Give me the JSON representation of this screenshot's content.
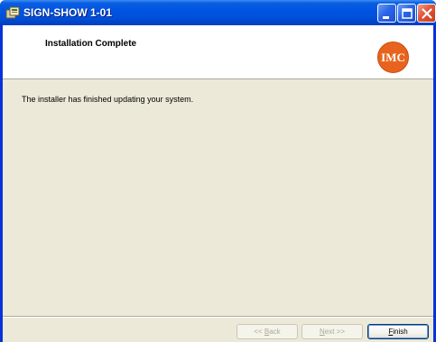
{
  "window": {
    "title": "SIGN-SHOW 1-01",
    "app_icon": "installer-icon",
    "controls": {
      "minimize_icon": "minimize-icon",
      "maximize_icon": "maximize-icon",
      "close_icon": "close-icon"
    }
  },
  "header": {
    "title": "Installation Complete",
    "logo_text": "IMC",
    "logo_color": "#e8641e"
  },
  "body": {
    "message": "The installer has finished updating your system."
  },
  "buttons": {
    "back": {
      "prefix": "<< ",
      "mnemonic": "B",
      "rest": "ack"
    },
    "next": {
      "mnemonic": "N",
      "rest": "ext >>"
    },
    "finish": {
      "mnemonic": "F",
      "rest": "inish"
    }
  },
  "colors": {
    "titlebar": "#0054e3",
    "dialog_bg": "#ece9d8",
    "close_button": "#e0543a"
  }
}
